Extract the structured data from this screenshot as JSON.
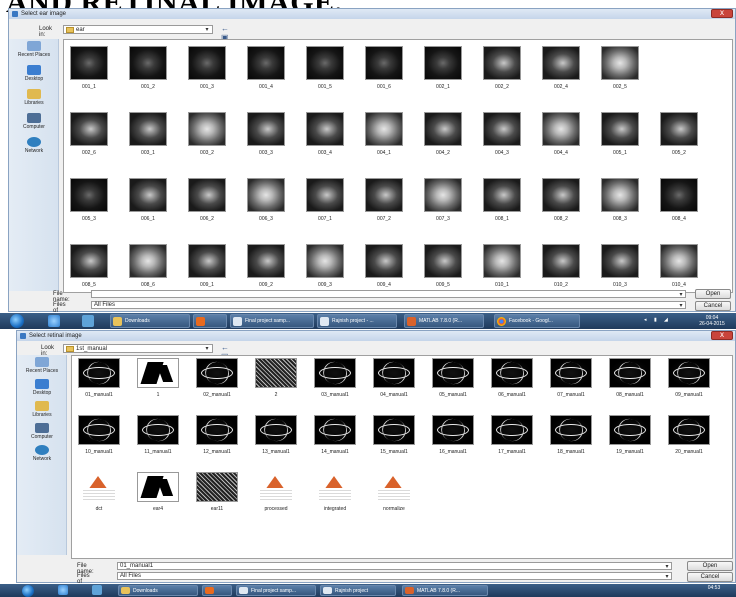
{
  "heading": "AND RETINAL IMAGE.",
  "dialog1": {
    "title": "Select ear image",
    "look_in_label": "Look in:",
    "look_in_value": "ear",
    "places": [
      "Recent Places",
      "Desktop",
      "Libraries",
      "Computer",
      "Network"
    ],
    "files": [
      "001_1",
      "001_2",
      "001_3",
      "001_4",
      "001_5",
      "001_6",
      "002_1",
      "002_2",
      "002_4",
      "002_5",
      "002_6",
      "003_1",
      "003_2",
      "003_3",
      "003_4",
      "004_1",
      "004_2",
      "004_3",
      "004_4",
      "005_1",
      "005_2",
      "005_3",
      "006_1",
      "006_2",
      "006_3",
      "007_1",
      "007_2",
      "007_3",
      "008_1",
      "008_2",
      "008_3",
      "008_4",
      "008_5",
      "008_6",
      "009_1",
      "009_2",
      "009_3",
      "009_4",
      "009_5",
      "010_1",
      "010_2",
      "010_3",
      "010_4"
    ],
    "file_name_label": "File name:",
    "file_name_value": "",
    "files_of_type_label": "Files of type:",
    "files_of_type_value": "All Files",
    "open_label": "Open",
    "cancel_label": "Cancel"
  },
  "taskbar1": {
    "tasks": [
      "Downloads",
      "",
      "Final project samp...",
      "Rajnish project - ...",
      "MATLAB 7.8.0 (R...",
      "Facebook - Googl..."
    ],
    "time": "09:04",
    "date": "26-04-2015"
  },
  "dialog2": {
    "title": "Select retinal image",
    "look_in_label": "Look in:",
    "look_in_value": "1st_manual",
    "places": [
      "Recent Places",
      "Desktop",
      "Libraries",
      "Computer",
      "Network"
    ],
    "files": [
      "01_manual1",
      "1",
      "02_manual1",
      "2",
      "03_manual1",
      "04_manual1",
      "05_manual1",
      "06_manual1",
      "07_manual1",
      "08_manual1",
      "09_manual1",
      "10_manual1",
      "11_manual1",
      "12_manual1",
      "13_manual1",
      "14_manual1",
      "15_manual1",
      "16_manual1",
      "17_manual1",
      "18_manual1",
      "19_manual1",
      "20_manual1",
      "dct",
      "ear4",
      "ear11",
      "processed",
      "integrated",
      "normalize"
    ],
    "file_name_label": "File name:",
    "file_name_value": "01_manual1",
    "files_of_type_label": "Files of type:",
    "files_of_type_value": "All Files",
    "open_label": "Open",
    "cancel_label": "Cancel"
  },
  "taskbar2": {
    "tasks": [
      "Downloads",
      "",
      "Final project samp...",
      "Rajnish project",
      "MATLAB 7.8.0 (R..."
    ],
    "time": "04:53"
  }
}
